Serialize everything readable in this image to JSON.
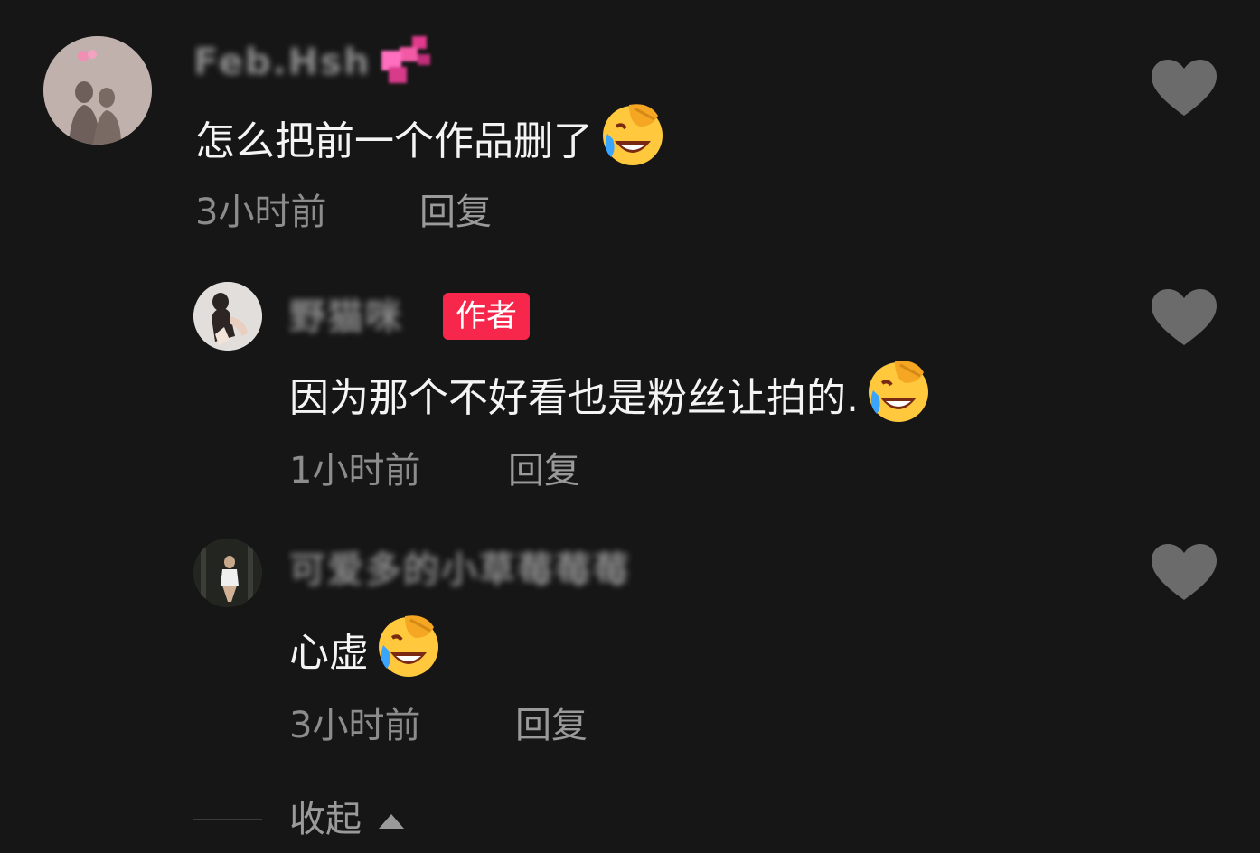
{
  "comments": [
    {
      "username": "Feb.Hsh",
      "text": "怎么把前一个作品删了",
      "emoji": "face-with-tears-of-joy-hand",
      "time": "3小时前",
      "reply_label": "回复",
      "is_author": false
    },
    {
      "username": "野猫咪",
      "author_badge": "作者",
      "text": "因为那个不好看也是粉丝让拍的.",
      "emoji": "face-with-tears-of-joy-hand",
      "time": "1小时前",
      "reply_label": "回复",
      "is_author": true
    },
    {
      "username": "可爱多的小草莓莓莓",
      "text": "心虚",
      "emoji": "face-with-tears-of-joy-hand",
      "time": "3小时前",
      "reply_label": "回复",
      "is_author": false
    }
  ],
  "collapse_label": "收起",
  "colors": {
    "background": "#161616",
    "badge": "#f6274b",
    "heart": "#6b6b6b",
    "meta_text": "#8c8c8c"
  }
}
